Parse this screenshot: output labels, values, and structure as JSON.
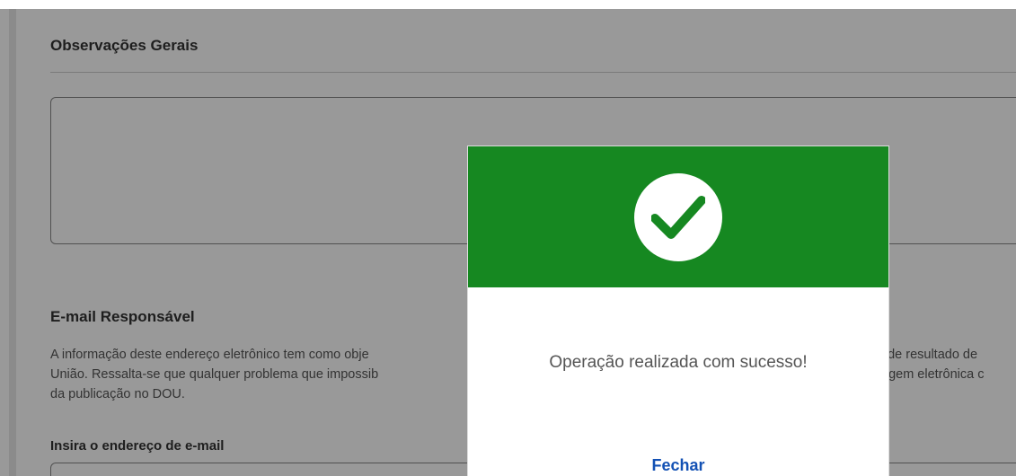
{
  "form": {
    "observacoes": {
      "title": "Observações Gerais",
      "value": ""
    },
    "email": {
      "title": "E-mail Responsável",
      "info_line1": "A informação deste endereço eletrônico tem como obje",
      "info_line1_right": "o de resultado de",
      "info_line2": "União. Ressalta-se que qualquer problema que impossib",
      "info_line2_right": "agem eletrônica c",
      "info_line3": "da publicação no DOU.",
      "field_label": "Insira o endereço de e-mail",
      "value": ""
    }
  },
  "modal": {
    "icon": "check-icon",
    "header_color": "#168821",
    "message": "Operação realizada com sucesso!",
    "close_label": "Fechar",
    "link_color": "#1351b4"
  }
}
